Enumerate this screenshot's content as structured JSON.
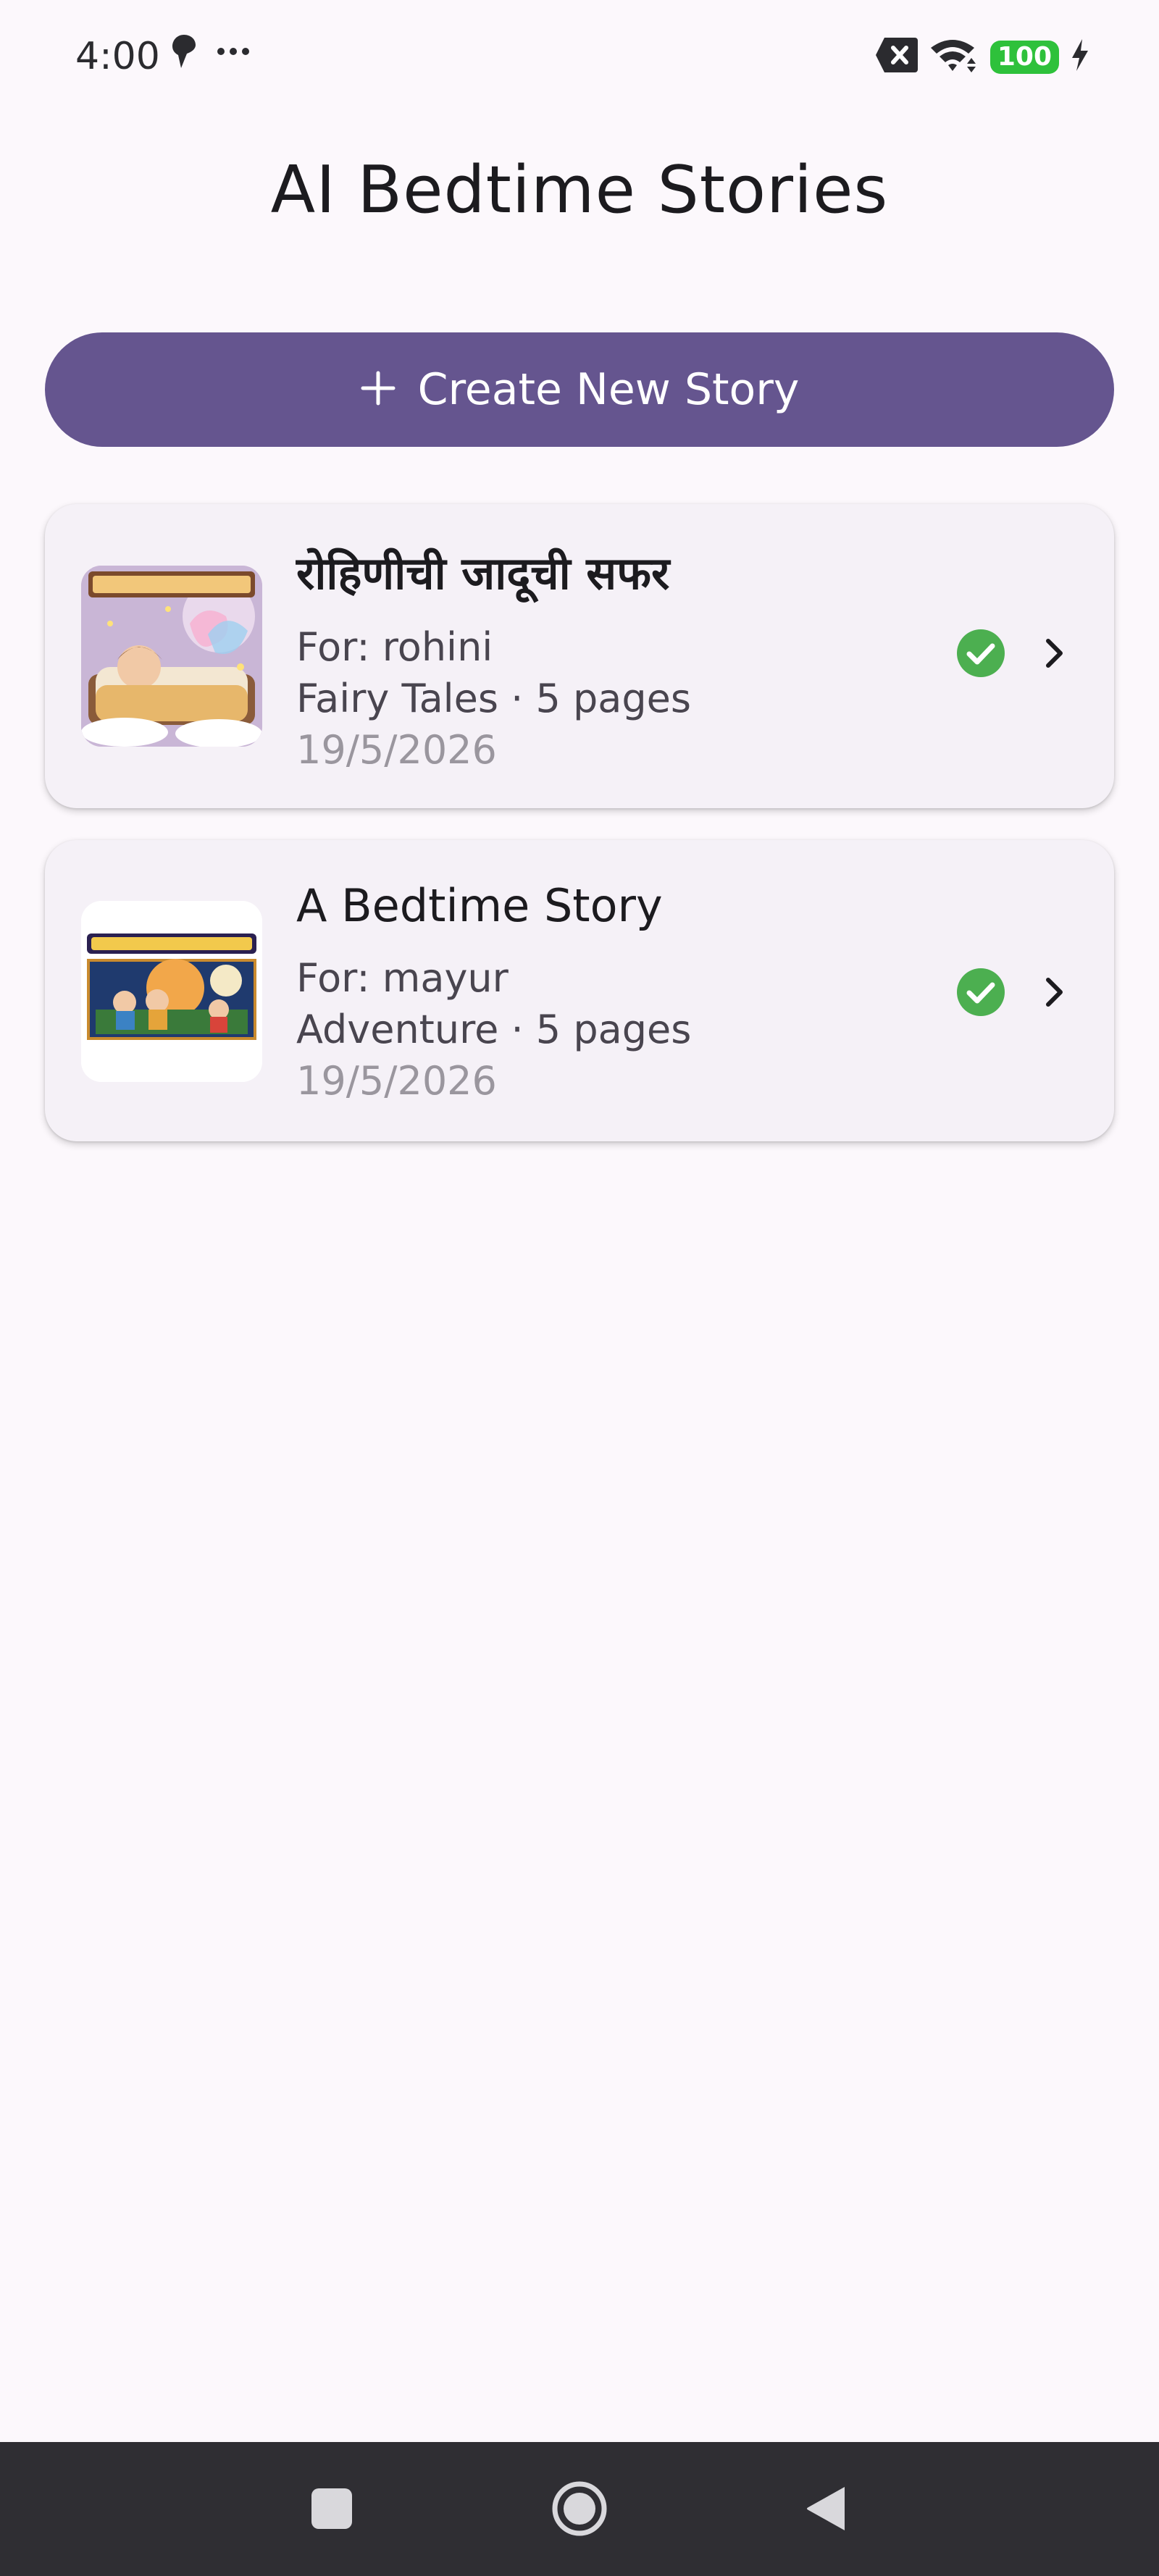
{
  "status_bar": {
    "time": "4:00",
    "left_icons": [
      "location-pin-icon",
      "more-dots-icon"
    ],
    "right_icons": [
      "notification-blocked-icon",
      "wifi-icon",
      "battery-icon",
      "charging-icon"
    ],
    "battery_level": "100",
    "battery_color": "#2ec13b"
  },
  "app": {
    "title": "AI Bedtime Stories",
    "accent_color": "#65558f"
  },
  "create_button": {
    "icon": "plus-icon",
    "label": "Create New Story"
  },
  "stories": [
    {
      "title": "रोहिणीची जादूची सफर",
      "for_line": "For: rohini",
      "genre_pages": "Fairy Tales · 5 pages",
      "date": "19/5/2026",
      "status_icon": "check-circle-icon",
      "status_color": "#4caf50",
      "thumbnail": "story-cover-fairy-bedroom"
    },
    {
      "title": "A Bedtime Story",
      "for_line": "For: mayur",
      "genre_pages": "Adventure · 5 pages",
      "date": "19/5/2026",
      "status_icon": "check-circle-icon",
      "status_color": "#4caf50",
      "thumbnail": "story-cover-space-adventure"
    }
  ],
  "nav_bar": {
    "buttons": [
      "recents-square-icon",
      "home-circle-icon",
      "back-triangle-icon"
    ]
  }
}
